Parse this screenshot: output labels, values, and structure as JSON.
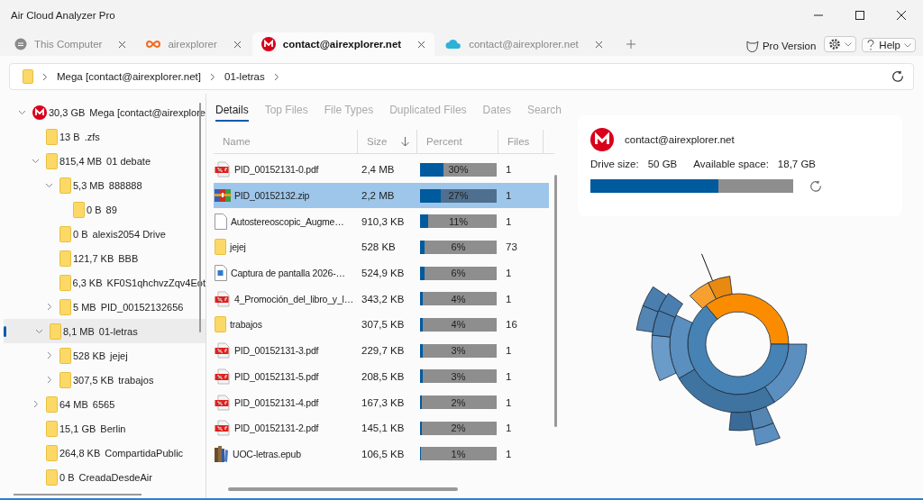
{
  "window": {
    "title": "Air Cloud Analyzer Pro"
  },
  "tabs": [
    {
      "label": "This Computer",
      "kind": "computer",
      "selected": false
    },
    {
      "label": "airexplorer",
      "kind": "airexplorer",
      "selected": false
    },
    {
      "label": "contact@airexplorer.net",
      "kind": "mega",
      "selected": true
    },
    {
      "label": "contact@airexplorer.net",
      "kind": "cloud",
      "selected": false
    }
  ],
  "toolbar": {
    "pro_label": "Pro Version",
    "help_label": "Help"
  },
  "breadcrumb": [
    "Mega [contact@airexplorer.net]",
    "01-letras"
  ],
  "tree": {
    "items": [
      {
        "size": "30,3 GB",
        "name": "Mega [contact@airexplore",
        "kind": "mega",
        "expanded": true,
        "selected": false,
        "children": [
          {
            "size": "13 B",
            "name": ".zfs",
            "kind": "folder",
            "selected": false
          },
          {
            "size": "815,4 MB",
            "name": "01 debate",
            "kind": "folder",
            "expanded": true,
            "selected": false,
            "children": [
              {
                "size": "5,3 MB",
                "name": "888888",
                "kind": "folder",
                "expanded": true,
                "selected": false,
                "children": [
                  {
                    "size": "0 B",
                    "name": "89",
                    "kind": "folder",
                    "selected": false
                  }
                ]
              },
              {
                "size": "0 B",
                "name": "alexis2054 Drive",
                "kind": "folder",
                "selected": false
              },
              {
                "size": "121,7 KB",
                "name": "BBB",
                "kind": "folder",
                "selected": false
              },
              {
                "size": "6,3 KB",
                "name": "KF0S1qhchvzZqv4Eot",
                "kind": "folder",
                "selected": false
              },
              {
                "size": "5 MB",
                "name": "PID_00152132656",
                "kind": "folder",
                "expanded": false,
                "selected": false
              }
            ]
          },
          {
            "size": "8,1 MB",
            "name": "01-letras",
            "kind": "folder",
            "expanded": true,
            "selected": true,
            "children": [
              {
                "size": "528 KB",
                "name": "jejej",
                "kind": "folder",
                "expanded": false,
                "selected": false
              },
              {
                "size": "307,5 KB",
                "name": "trabajos",
                "kind": "folder",
                "expanded": false,
                "selected": false
              }
            ]
          },
          {
            "size": "64 MB",
            "name": "6565",
            "kind": "folder",
            "expanded": false,
            "selected": false
          },
          {
            "size": "15,1 GB",
            "name": "Berlin",
            "kind": "folder",
            "selected": false
          },
          {
            "size": "264,8 KB",
            "name": "CompartidaPublic",
            "kind": "folder",
            "selected": false
          },
          {
            "size": "0 B",
            "name": "CreadaDesdeAir",
            "kind": "folder",
            "selected": false
          }
        ]
      }
    ]
  },
  "view_tabs": [
    {
      "label": "Details",
      "selected": true
    },
    {
      "label": "Top Files",
      "selected": false
    },
    {
      "label": "File Types",
      "selected": false
    },
    {
      "label": "Duplicated Files",
      "selected": false
    },
    {
      "label": "Dates",
      "selected": false
    },
    {
      "label": "Search",
      "selected": false
    }
  ],
  "table": {
    "columns": [
      {
        "label": "Name",
        "sorted": false
      },
      {
        "label": "Size",
        "sorted": true
      },
      {
        "label": "Percent",
        "sorted": false
      },
      {
        "label": "Files",
        "sorted": false
      }
    ],
    "rows": [
      {
        "kind": "pdf",
        "name": "PID_00152131-0.pdf",
        "size": "2,4 MB",
        "level": 0.3,
        "percent": "30%",
        "files": "1",
        "selected": false
      },
      {
        "kind": "zip",
        "name": "PID_00152132.zip",
        "size": "2,2 MB",
        "level": 0.27,
        "percent": "27%",
        "files": "1",
        "selected": true
      },
      {
        "kind": "file",
        "name": "Autostereoscopic_Augme…",
        "size": "910,3 KB",
        "level": 0.11,
        "percent": "11%",
        "files": "1",
        "selected": false
      },
      {
        "kind": "folder",
        "name": "jejej",
        "size": "528 KB",
        "level": 0.06,
        "percent": "6%",
        "files": "73",
        "selected": false
      },
      {
        "kind": "image",
        "name": "Captura de pantalla 2026-…",
        "size": "524,9 KB",
        "level": 0.06,
        "percent": "6%",
        "files": "1",
        "selected": false
      },
      {
        "kind": "pdf",
        "name": "4_Promoción_del_libro_y_l…",
        "size": "343,2 KB",
        "level": 0.04,
        "percent": "4%",
        "files": "1",
        "selected": false
      },
      {
        "kind": "folder",
        "name": "trabajos",
        "size": "307,5 KB",
        "level": 0.04,
        "percent": "4%",
        "files": "16",
        "selected": false
      },
      {
        "kind": "pdf",
        "name": "PID_00152131-3.pdf",
        "size": "229,7 KB",
        "level": 0.03,
        "percent": "3%",
        "files": "1",
        "selected": false
      },
      {
        "kind": "pdf",
        "name": "PID_00152131-5.pdf",
        "size": "208,5 KB",
        "level": 0.03,
        "percent": "3%",
        "files": "1",
        "selected": false
      },
      {
        "kind": "pdf",
        "name": "PID_00152131-4.pdf",
        "size": "167,3 KB",
        "level": 0.02,
        "percent": "2%",
        "files": "1",
        "selected": false
      },
      {
        "kind": "pdf",
        "name": "PID_00152131-2.pdf",
        "size": "145,1 KB",
        "level": 0.02,
        "percent": "2%",
        "files": "1",
        "selected": false
      },
      {
        "kind": "epub",
        "name": "UOC-letras.epub",
        "size": "106,5 KB",
        "level": 0.01,
        "percent": "1%",
        "files": "1",
        "selected": false
      }
    ]
  },
  "drive": {
    "account": "contact@airexplorer.net",
    "size_label": "Drive size:",
    "size": "50 GB",
    "available_label": "Available space:",
    "available": "18,7 GB",
    "level": 0.63
  }
}
